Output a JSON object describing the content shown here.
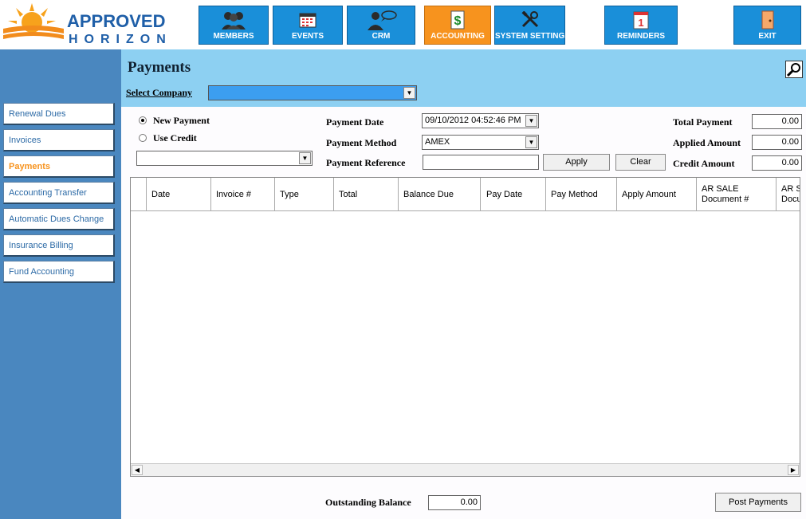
{
  "app": {
    "logo_text_top": "APPROVED",
    "logo_text_bottom": "HORIZON"
  },
  "nav": {
    "members": "MEMBERS",
    "events": "EVENTS",
    "crm": "CRM",
    "accounting": "ACCOUNTING",
    "system_settings": "SYSTEM SETTINGS",
    "reminders": "REMINDERS",
    "exit": "EXIT"
  },
  "sidebar": {
    "items": [
      {
        "label": "Renewal Dues"
      },
      {
        "label": "Invoices"
      },
      {
        "label": "Payments"
      },
      {
        "label": "Accounting Transfer"
      },
      {
        "label": "Automatic Dues Change"
      },
      {
        "label": "Insurance Billing"
      },
      {
        "label": "Fund Accounting"
      }
    ]
  },
  "page": {
    "title": "Payments",
    "select_company_label": "Select Company",
    "select_company_value": ""
  },
  "form": {
    "new_payment_label": "New Payment",
    "use_credit_label": "Use Credit",
    "credit_select_value": "",
    "payment_date_label": "Payment Date",
    "payment_date_value": "09/10/2012 04:52:46 PM",
    "payment_method_label": "Payment Method",
    "payment_method_value": "AMEX",
    "payment_reference_label": "Payment Reference",
    "payment_reference_value": "",
    "apply_label": "Apply",
    "clear_label": "Clear",
    "total_payment_label": "Total Payment",
    "total_payment_value": "0.00",
    "applied_amount_label": "Applied Amount",
    "applied_amount_value": "0.00",
    "credit_amount_label": "Credit Amount",
    "credit_amount_value": "0.00"
  },
  "grid": {
    "columns": [
      "Date",
      "Invoice #",
      "Type",
      "Total",
      "Balance Due",
      "Pay Date",
      "Pay Method",
      "Apply Amount",
      "AR SALE Document #",
      "AR S Docu"
    ]
  },
  "footer": {
    "outstanding_balance_label": "Outstanding Balance",
    "outstanding_balance_value": "0.00",
    "post_payments_label": "Post Payments"
  },
  "colors": {
    "nav_blue": "#1a8fd9",
    "nav_active_orange": "#f7931e",
    "sidebar_blue": "#4a87bf",
    "header_light_blue": "#8dd0f2"
  }
}
